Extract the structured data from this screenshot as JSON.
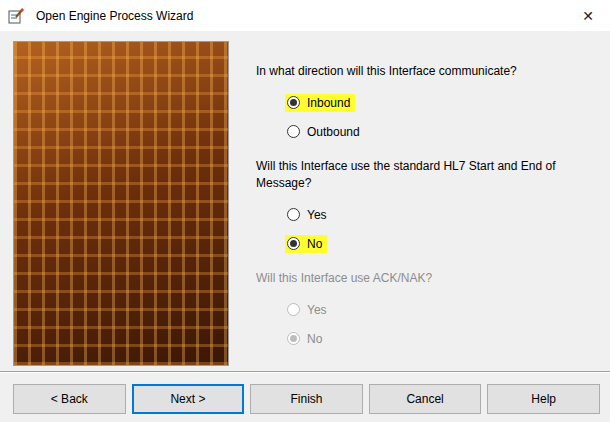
{
  "window": {
    "title": "Open Engine Process Wizard",
    "close": "✕"
  },
  "questions": [
    {
      "prompt": "In what direction will this Interface communicate?",
      "disabled": false,
      "options": [
        {
          "label": "Inbound",
          "selected": true,
          "highlighted": true
        },
        {
          "label": "Outbound",
          "selected": false,
          "highlighted": false
        }
      ]
    },
    {
      "prompt": "Will this Interface use the standard HL7 Start and End of Message?",
      "disabled": false,
      "options": [
        {
          "label": "Yes",
          "selected": false,
          "highlighted": false
        },
        {
          "label": "No",
          "selected": true,
          "highlighted": true
        }
      ]
    },
    {
      "prompt": "Will this Interface use ACK/NAK?",
      "disabled": true,
      "options": [
        {
          "label": "Yes",
          "selected": false,
          "highlighted": false
        },
        {
          "label": "No",
          "selected": true,
          "highlighted": false
        }
      ]
    }
  ],
  "buttons": [
    {
      "label": "< Back",
      "focused": false
    },
    {
      "label": "Next >",
      "focused": true
    },
    {
      "label": "Finish",
      "focused": false
    },
    {
      "label": "Cancel",
      "focused": false
    },
    {
      "label": "Help",
      "focused": false
    }
  ]
}
